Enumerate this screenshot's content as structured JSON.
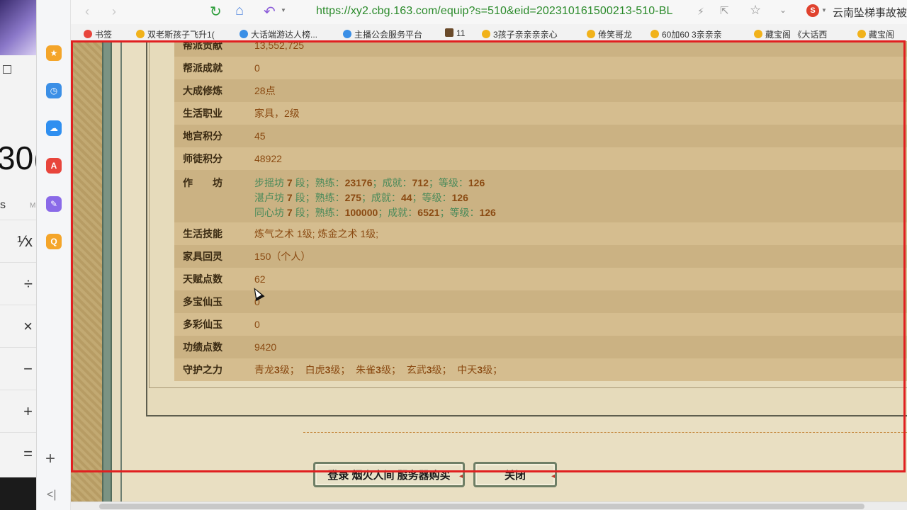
{
  "calculator": {
    "display_value": "30(",
    "memory_s": "s",
    "memory_m": "M",
    "ops": [
      "¹⁄x",
      "÷",
      "×",
      "−",
      "+",
      "="
    ]
  },
  "sidebar": {
    "icons": [
      {
        "name": "favorites-icon",
        "color": "#f4a52a",
        "glyph": "★"
      },
      {
        "name": "history-icon",
        "color": "#3b8fe6",
        "glyph": "◷"
      },
      {
        "name": "cloud-icon",
        "color": "#2f8ff0",
        "glyph": "☁"
      },
      {
        "name": "pdf-icon",
        "color": "#e8453c",
        "glyph": "A"
      },
      {
        "name": "note-icon",
        "color": "#8a6ae8",
        "glyph": "✎"
      },
      {
        "name": "search-tool-icon",
        "color": "#f4a52a",
        "glyph": "Q"
      }
    ],
    "plus": "+",
    "collapse": "<|"
  },
  "toolbar": {
    "back": "‹",
    "forward": "›",
    "url": "https://xy2.cbg.163.com/equip?s=510&eid=202310161500213-510-BL",
    "search_text": "云南坠梯事故被提纵调查"
  },
  "bookmarks": [
    {
      "label": "书签"
    },
    {
      "label": "双老斯孩子飞升1("
    },
    {
      "label": "大话端游达人榜..."
    },
    {
      "label": "主播公会服务平台"
    },
    {
      "label": "11"
    },
    {
      "label": "3孩子亲亲亲亲心"
    },
    {
      "label": "倦笑哥龙"
    },
    {
      "label": "60加60 3亲亲亲"
    },
    {
      "label": "藏宝阁 《大话西"
    },
    {
      "label": "藏宝阁"
    }
  ],
  "info_rows": [
    {
      "label": "帮派贡献",
      "value": "13,552,725"
    },
    {
      "label": "帮派成就",
      "value": "0"
    },
    {
      "label": "大成修炼",
      "value": "28点"
    },
    {
      "label": "生活职业",
      "value": "家具，2级"
    },
    {
      "label": "地宫积分",
      "value": "45"
    },
    {
      "label": "师徒积分",
      "value": "48922"
    },
    {
      "label": "作　　坊",
      "value": ""
    },
    {
      "label": "生活技能",
      "value": "炼气之术 1级; 炼金之术 1级;"
    },
    {
      "label": "家具回灵",
      "value": "150（个人）"
    },
    {
      "label": "天赋点数",
      "value": "62"
    },
    {
      "label": "多宝仙玉",
      "value": "0"
    },
    {
      "label": "多彩仙玉",
      "value": "0"
    },
    {
      "label": "功绩点数",
      "value": "9420"
    },
    {
      "label": "守护之力",
      "value": ""
    }
  ],
  "workshops": [
    {
      "name": "步摇坊",
      "duan": "7",
      "proficiency": "23176",
      "achievement": "712",
      "level": "126"
    },
    {
      "name": "湛卢坊",
      "duan": "7",
      "proficiency": "275",
      "achievement": "44",
      "level": "126"
    },
    {
      "name": "同心坊",
      "duan": "7",
      "proficiency": "100000",
      "achievement": "6521",
      "level": "126"
    }
  ],
  "workshop_labels": {
    "duan": "段；熟练：",
    "achievement": "；成就：",
    "level": "；等级："
  },
  "guardians": [
    {
      "name": "青龙",
      "level": "3",
      "unit": "级；"
    },
    {
      "name": "白虎",
      "level": "3",
      "unit": "级；"
    },
    {
      "name": "朱雀",
      "level": "3",
      "unit": "级；"
    },
    {
      "name": "玄武",
      "level": "3",
      "unit": "级；"
    },
    {
      "name": "中天",
      "level": "3",
      "unit": "级；"
    }
  ],
  "buttons": {
    "login": "登录 烟火人间 服务器购买",
    "close": "关闭"
  },
  "colors": {
    "highlight": "#e02020",
    "url_green": "#2a8a2a",
    "value_brown": "#8a4a12",
    "workshop_green": "#4a8a5a"
  }
}
